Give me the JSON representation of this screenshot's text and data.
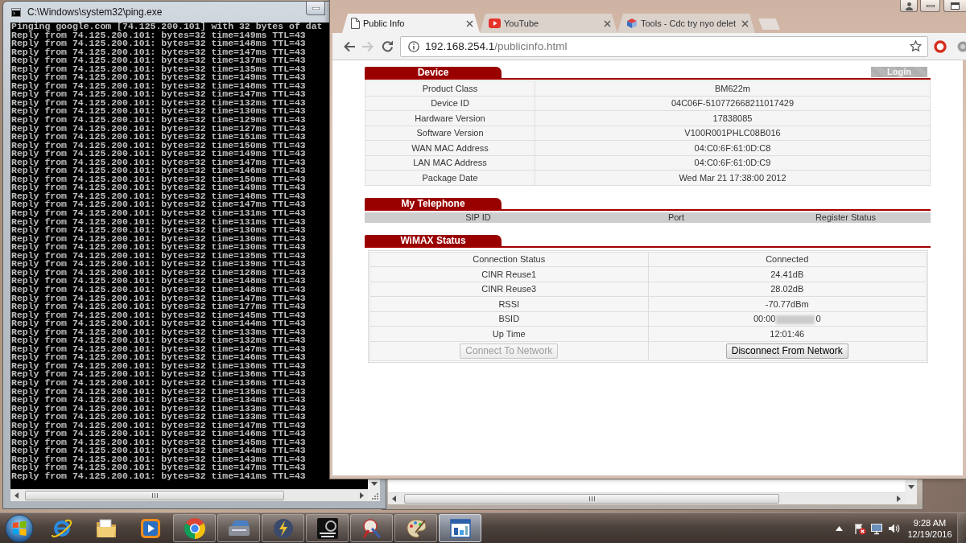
{
  "console": {
    "title": "C:\\Windows\\system32\\ping.exe",
    "lines": [
      "Pinging google.com [74.125.200.101] with 32 bytes of dat",
      "Reply from 74.125.200.101: bytes=32 time=149ms TTL=43",
      "Reply from 74.125.200.101: bytes=32 time=148ms TTL=43",
      "Reply from 74.125.200.101: bytes=32 time=147ms TTL=43",
      "Reply from 74.125.200.101: bytes=32 time=137ms TTL=43",
      "Reply from 74.125.200.101: bytes=32 time=135ms TTL=43",
      "Reply from 74.125.200.101: bytes=32 time=149ms TTL=43",
      "Reply from 74.125.200.101: bytes=32 time=148ms TTL=43",
      "Reply from 74.125.200.101: bytes=32 time=147ms TTL=43",
      "Reply from 74.125.200.101: bytes=32 time=132ms TTL=43",
      "Reply from 74.125.200.101: bytes=32 time=130ms TTL=43",
      "Reply from 74.125.200.101: bytes=32 time=129ms TTL=43",
      "Reply from 74.125.200.101: bytes=32 time=127ms TTL=43",
      "Reply from 74.125.200.101: bytes=32 time=151ms TTL=43",
      "Reply from 74.125.200.101: bytes=32 time=150ms TTL=43",
      "Reply from 74.125.200.101: bytes=32 time=149ms TTL=43",
      "Reply from 74.125.200.101: bytes=32 time=147ms TTL=43",
      "Reply from 74.125.200.101: bytes=32 time=146ms TTL=43",
      "Reply from 74.125.200.101: bytes=32 time=150ms TTL=43",
      "Reply from 74.125.200.101: bytes=32 time=149ms TTL=43",
      "Reply from 74.125.200.101: bytes=32 time=148ms TTL=43",
      "Reply from 74.125.200.101: bytes=32 time=147ms TTL=43",
      "Reply from 74.125.200.101: bytes=32 time=131ms TTL=43",
      "Reply from 74.125.200.101: bytes=32 time=131ms TTL=43",
      "Reply from 74.125.200.101: bytes=32 time=130ms TTL=43",
      "Reply from 74.125.200.101: bytes=32 time=130ms TTL=43",
      "Reply from 74.125.200.101: bytes=32 time=130ms TTL=43",
      "Reply from 74.125.200.101: bytes=32 time=135ms TTL=43",
      "Reply from 74.125.200.101: bytes=32 time=139ms TTL=43",
      "Reply from 74.125.200.101: bytes=32 time=128ms TTL=43",
      "Reply from 74.125.200.101: bytes=32 time=148ms TTL=43",
      "Reply from 74.125.200.101: bytes=32 time=148ms TTL=43",
      "Reply from 74.125.200.101: bytes=32 time=147ms TTL=43",
      "Reply from 74.125.200.101: bytes=32 time=177ms TTL=43",
      "Reply from 74.125.200.101: bytes=32 time=145ms TTL=43",
      "Reply from 74.125.200.101: bytes=32 time=144ms TTL=43",
      "Reply from 74.125.200.101: bytes=32 time=133ms TTL=43",
      "Reply from 74.125.200.101: bytes=32 time=132ms TTL=43",
      "Reply from 74.125.200.101: bytes=32 time=147ms TTL=43",
      "Reply from 74.125.200.101: bytes=32 time=146ms TTL=43",
      "Reply from 74.125.200.101: bytes=32 time=136ms TTL=43",
      "Reply from 74.125.200.101: bytes=32 time=136ms TTL=43",
      "Reply from 74.125.200.101: bytes=32 time=136ms TTL=43",
      "Reply from 74.125.200.101: bytes=32 time=135ms TTL=43",
      "Reply from 74.125.200.101: bytes=32 time=134ms TTL=43",
      "Reply from 74.125.200.101: bytes=32 time=133ms TTL=43",
      "Reply from 74.125.200.101: bytes=32 time=133ms TTL=43",
      "Reply from 74.125.200.101: bytes=32 time=147ms TTL=43",
      "Reply from 74.125.200.101: bytes=32 time=146ms TTL=43",
      "Reply from 74.125.200.101: bytes=32 time=145ms TTL=43",
      "Reply from 74.125.200.101: bytes=32 time=144ms TTL=43",
      "Reply from 74.125.200.101: bytes=32 time=143ms TTL=43",
      "Reply from 74.125.200.101: bytes=32 time=147ms TTL=43",
      "Reply from 74.125.200.101: bytes=32 time=141ms TTL=43"
    ]
  },
  "browser": {
    "tabs": [
      {
        "kind": "page",
        "title": "Public Info",
        "selected": true
      },
      {
        "kind": "video",
        "title": "YouTube",
        "selected": false
      },
      {
        "kind": "cube",
        "title": "Tools - Cdc try nyo delet",
        "selected": false
      }
    ],
    "nav_buttons": [
      {
        "kind": "back",
        "disabled": false
      },
      {
        "kind": "forward",
        "disabled": true
      },
      {
        "kind": "reload",
        "disabled": false
      }
    ],
    "address": {
      "host": "192.168.254.1",
      "path": "/publicinfo.html"
    }
  },
  "page": {
    "device": {
      "title": "Device",
      "login": "Login",
      "rows": [
        {
          "label": "Product Class",
          "value": "BM622m"
        },
        {
          "label": "Device ID",
          "value": "04C06F-510772668211017429"
        },
        {
          "label": "Hardware Version",
          "value": "17838085"
        },
        {
          "label": "Software Version",
          "value": "V100R001PHLC08B016"
        },
        {
          "label": "WAN MAC Address",
          "value": "04:C0:6F:61:0D:C8"
        },
        {
          "label": "LAN MAC Address",
          "value": "04:C0:6F:61:0D:C9"
        },
        {
          "label": "Package Date",
          "value": "Wed Mar 21 17:38:00 2012"
        }
      ]
    },
    "telephone": {
      "title": "My Telephone",
      "columns": [
        "SIP ID",
        "Port",
        "Register Status"
      ]
    },
    "wimax": {
      "title": "WiMAX Status",
      "rows": [
        {
          "label": "Connection Status",
          "value": "Connected",
          "masked": false
        },
        {
          "label": "CINR Reuse1",
          "value": "24.41dB",
          "masked": false
        },
        {
          "label": "CINR Reuse3",
          "value": "28.02dB",
          "masked": false
        },
        {
          "label": "RSSI",
          "value": "-70.77dBm",
          "masked": false
        },
        {
          "label": "BSID",
          "value": "00:00",
          "masked": true,
          "value_end": "0"
        },
        {
          "label": "Up Time",
          "value": "12:01:46",
          "masked": false
        }
      ],
      "buttons": [
        {
          "label": "Connect To Network",
          "disabled": true
        },
        {
          "label": "Disconnect From Network",
          "disabled": false
        }
      ]
    }
  },
  "taskbar": {
    "apps": [
      {
        "kind": "globe",
        "running": false,
        "selected": false
      },
      {
        "kind": "folder",
        "running": false,
        "selected": false
      },
      {
        "kind": "media",
        "running": false,
        "selected": false
      },
      {
        "kind": "ring",
        "running": true,
        "selected": false
      },
      {
        "kind": "scanner",
        "running": true,
        "selected": false
      },
      {
        "kind": "bolt",
        "running": true,
        "selected": false
      },
      {
        "kind": "game",
        "running": true,
        "selected": false
      },
      {
        "kind": "brush",
        "running": true,
        "selected": false
      },
      {
        "kind": "palette",
        "running": true,
        "selected": false
      },
      {
        "kind": "window",
        "running": true,
        "selected": true
      }
    ],
    "clock": {
      "time": "9:28 AM",
      "date": "12/19/2016"
    }
  }
}
